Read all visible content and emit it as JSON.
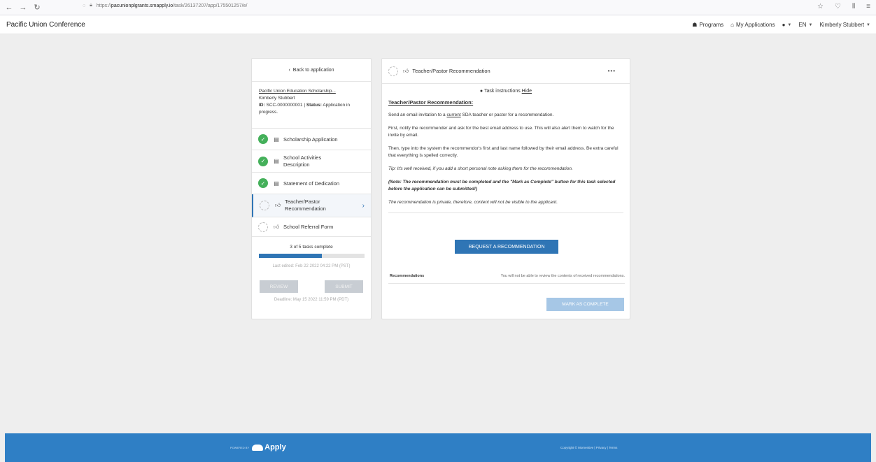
{
  "browser": {
    "url_prefix": "https://",
    "url_host": "pacunionplgrants.smapply.io",
    "url_path": "/task/26137207/app/175501257/e/"
  },
  "header": {
    "org_name": "Pacific Union Conference",
    "programs": "Programs",
    "my_applications": "My Applications",
    "language": "EN",
    "user_name": "Kimberly Stubbert"
  },
  "sidebar": {
    "back_label": "Back to application",
    "program_name": "Pacific Union Education Scholarship...",
    "applicant": "Kimberly Stubbert",
    "id_label": "ID:",
    "id_value": "SCC-0000000001",
    "status_label": "Status:",
    "status_value": "Application in progress.",
    "tasks": [
      {
        "label": "Scholarship Application",
        "complete": true
      },
      {
        "label": "School Activities Description",
        "complete": true
      },
      {
        "label": "Statement of Dedication",
        "complete": true
      },
      {
        "label": "Teacher/Pastor Recommendation",
        "complete": false,
        "active": true
      },
      {
        "label": "School Referral Form",
        "complete": false
      }
    ],
    "progress_text": "3 of 5 tasks complete",
    "progress_fraction": 0.6,
    "last_edited": "Last edited: Feb 22 2022 04:22 PM (PST)",
    "review_label": "REVIEW",
    "submit_label": "SUBMIT",
    "deadline": "Deadline: May 15 2022 11:59 PM (PDT)"
  },
  "main": {
    "title": "Teacher/Pastor Recommendation",
    "more_label": "•••",
    "instructions_label": "Task instructions",
    "hide_label": "Hide",
    "instr_title": "Teacher/Pastor Recommendation:",
    "p1_pre": "Send an email invitation to a ",
    "p1_u": "current",
    "p1_post": " SDA teacher or pastor for a recommendation.",
    "p2": "First, notify the recommender and ask for the best email address to use. This will also alert them to watch for the invite by email.",
    "p3": "Then, type into the system the recommendor's first and last name followed by their email address. Be extra careful that everything is spelled correctly.",
    "p4": "Tip: It's well received, if you add a short personal note asking them for the recommendation.",
    "p5": "(Note: The recommendation must be completed and the \"Mark as Complete\" button for this task selected before the application can be submitted!)",
    "p6": "The recommendation is private, therefore, content will not be visible to the applicant.",
    "request_button": "REQUEST A RECOMMENDATION",
    "recommendations_label": "Recommendations",
    "recommendations_note": "You will not be able to review the contents of received recommendations.",
    "mark_complete": "MARK AS COMPLETE"
  },
  "footer": {
    "powered_by": "POWERED BY",
    "brand": "Apply",
    "copyright": "Copyright © Momentive | Privacy | Terms"
  },
  "colors": {
    "accent": "#2f75b5",
    "footer": "#2f7fc5",
    "check": "#44b05a"
  }
}
